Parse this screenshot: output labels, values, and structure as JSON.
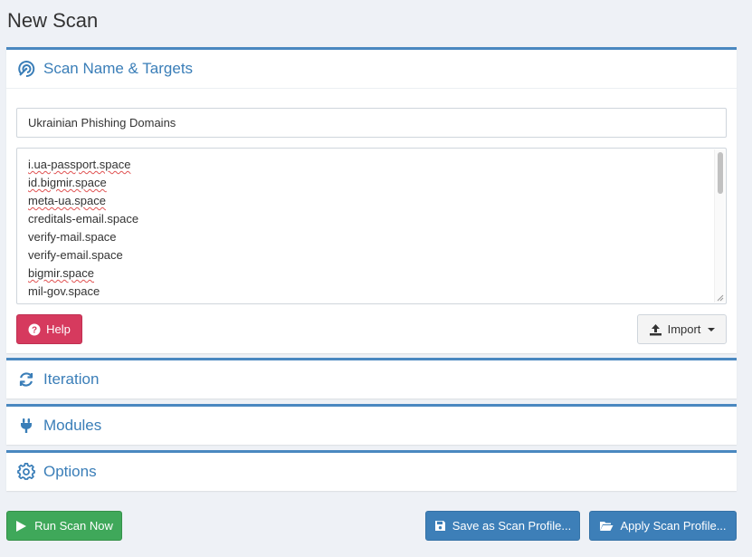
{
  "page": {
    "title": "New Scan"
  },
  "sections": {
    "targets": {
      "title": "Scan Name & Targets",
      "icon": "radar-icon"
    },
    "iteration": {
      "title": "Iteration",
      "icon": "sync-icon"
    },
    "modules": {
      "title": "Modules",
      "icon": "plug-icon"
    },
    "options": {
      "title": "Options",
      "icon": "gear-icon"
    }
  },
  "scan_name": {
    "value": "Ukrainian Phishing Domains"
  },
  "targets": {
    "items": [
      {
        "text": "i.ua-passport.space",
        "spellcheck": true
      },
      {
        "text": "id.bigmir.space",
        "spellcheck": true
      },
      {
        "text": "meta-ua.space",
        "spellcheck": true
      },
      {
        "text": "creditals-email.space",
        "spellcheck": false
      },
      {
        "text": "verify-mail.space",
        "spellcheck": false
      },
      {
        "text": "verify-email.space",
        "spellcheck": false
      },
      {
        "text": "bigmir.space",
        "spellcheck": true
      },
      {
        "text": "mil-gov.space",
        "spellcheck": false
      }
    ]
  },
  "buttons": {
    "help": "Help",
    "import": "Import",
    "run": "Run Scan Now",
    "save_profile": "Save as Scan Profile...",
    "apply_profile": "Apply Scan Profile..."
  },
  "colors": {
    "accent": "#4a88c0",
    "help": "#d63a5e",
    "run": "#3fa85a",
    "profile": "#3d7fb8"
  }
}
